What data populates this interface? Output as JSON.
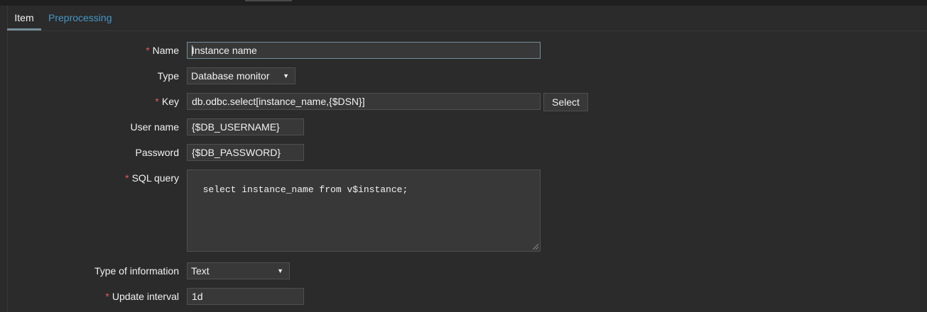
{
  "tabs": [
    {
      "label": "Item"
    },
    {
      "label": "Preprocessing"
    }
  ],
  "form": {
    "name": {
      "label": "Name",
      "value": "Instance name"
    },
    "type": {
      "label": "Type",
      "value": "Database monitor"
    },
    "key": {
      "label": "Key",
      "value": "db.odbc.select[instance_name,{$DSN}]",
      "button": "Select"
    },
    "username": {
      "label": "User name",
      "value": "{$DB_USERNAME}"
    },
    "password": {
      "label": "Password",
      "value": "{$DB_PASSWORD}"
    },
    "sql_query": {
      "label": "SQL query",
      "value": "select instance_name from v$instance;"
    },
    "type_of_information": {
      "label": "Type of information",
      "value": "Text"
    },
    "update_interval": {
      "label": "Update interval",
      "value": "1d"
    }
  },
  "icons": {
    "dropdown": "triangle-down-icon",
    "required": "asterisk"
  },
  "colors": {
    "background": "#2b2b2b",
    "field": "#383838",
    "link": "#4796c4",
    "required": "#e45959"
  }
}
